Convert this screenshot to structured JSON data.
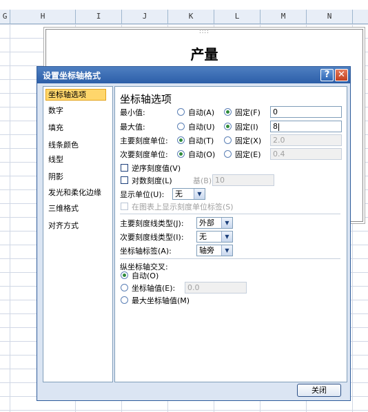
{
  "spreadsheet": {
    "columns": [
      "G",
      "H",
      "I",
      "J",
      "K",
      "L",
      "M",
      "N"
    ]
  },
  "chart": {
    "title": "产量",
    "handle_glyph": "::::"
  },
  "dialog": {
    "title": "设置坐标轴格式",
    "help_glyph": "?",
    "close_glyph": "✕",
    "nav_items": [
      "坐标轴选项",
      "数字",
      "填充",
      "线条颜色",
      "线型",
      "阴影",
      "发光和柔化边缘",
      "三维格式",
      "对齐方式"
    ],
    "section_title": "坐标轴选项",
    "min_label": "最小值:",
    "max_label": "最大值:",
    "major_label": "主要刻度单位:",
    "minor_label": "次要刻度单位:",
    "auto_a": "自动(A)",
    "fixed_f": "固定(F)",
    "auto_u": "自动(U)",
    "fixed_i": "固定(I)",
    "auto_t": "自动(T)",
    "fixed_x": "固定(X)",
    "auto_o": "自动(O)",
    "fixed_e": "固定(E)",
    "min_value": "0",
    "max_value": "8",
    "major_value": "2.0",
    "minor_value": "0.4",
    "reverse_label": "逆序刻度值(V)",
    "log_label": "对数刻度(L)",
    "base_label": "基(B):",
    "base_value": "10",
    "display_units_label": "显示单位(U):",
    "display_units_value": "无",
    "show_units_label": "在图表上显示刻度单位标签(S)",
    "major_tick_label": "主要刻度线类型(J):",
    "major_tick_value": "外部",
    "minor_tick_label": "次要刻度线类型(I):",
    "minor_tick_value": "无",
    "axis_labels_label": "坐标轴标签(A):",
    "axis_labels_value": "轴旁",
    "cross_title": "纵坐标轴交叉:",
    "cross_auto": "自动(O)",
    "cross_value_label": "坐标轴值(E):",
    "cross_value": "0.0",
    "cross_max": "最大坐标轴值(M)",
    "close_button": "关闭"
  }
}
